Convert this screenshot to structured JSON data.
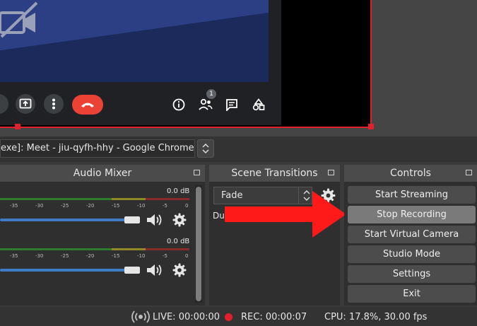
{
  "source": {
    "window_label": "exe]: Meet - jiu-qyfh-hhy - Google Chrome"
  },
  "meet": {
    "participant_count": "1"
  },
  "panels": {
    "audio_mixer": "Audio Mixer",
    "scene_transitions": "Scene Transitions",
    "controls": "Controls"
  },
  "mixer": {
    "tracks": [
      {
        "db": "0.0 dB",
        "ticks": [
          "-35",
          "-30",
          "-25",
          "-20",
          "-15",
          "-10",
          "-5",
          "0"
        ]
      },
      {
        "db": "0.0 dB",
        "ticks": [
          "-35",
          "-30",
          "-25",
          "-20",
          "-15",
          "-10",
          "-5",
          "0"
        ]
      }
    ]
  },
  "transitions": {
    "selected": "Fade",
    "duration_label": "Dur"
  },
  "controls": {
    "start_streaming": "Start Streaming",
    "stop_recording": "Stop Recording",
    "start_virtual_camera": "Start Virtual Camera",
    "studio_mode": "Studio Mode",
    "settings": "Settings",
    "exit": "Exit"
  },
  "status": {
    "live": "LIVE: 00:00:00",
    "rec": "REC: 00:00:07",
    "cpu": "CPU: 17.8%, 30.00 fps"
  },
  "colors": {
    "accent_red": "#e0202a",
    "fader_blue": "#3e7cc6",
    "arrow_red": "#ff1a1a",
    "hangup_red": "#ea4335"
  }
}
